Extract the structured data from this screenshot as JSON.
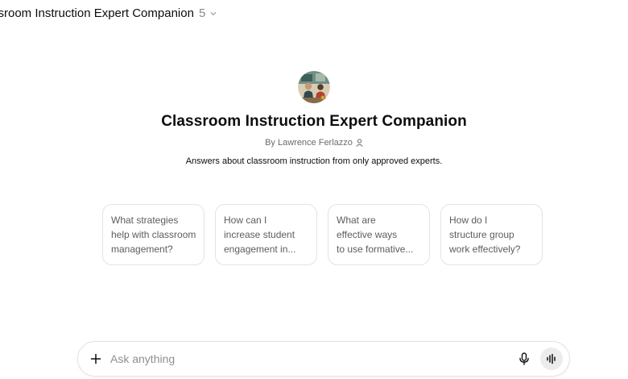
{
  "header": {
    "model_name": "ssroom Instruction Expert Companion",
    "model_version": "5"
  },
  "gpt": {
    "title": "Classroom Instruction Expert Companion",
    "author": "By Lawrence Ferlazzo",
    "description": "Answers about classroom instruction from only approved experts."
  },
  "suggestions": [
    {
      "lines": [
        "What strategies",
        "help with classroom",
        "management?"
      ]
    },
    {
      "lines": [
        "How can I",
        "increase student",
        "engagement in..."
      ]
    },
    {
      "lines": [
        "What are",
        "effective ways",
        "to use formative..."
      ]
    },
    {
      "lines": [
        "How do I",
        "structure group",
        "work effectively?"
      ]
    }
  ],
  "composer": {
    "placeholder": "Ask anything",
    "value": ""
  },
  "icons": {
    "model_dropdown": "chevron-down-icon",
    "author_profile": "person-icon",
    "add": "plus-icon",
    "dictate": "microphone-icon",
    "voice_mode": "voice-waveform-icon"
  }
}
